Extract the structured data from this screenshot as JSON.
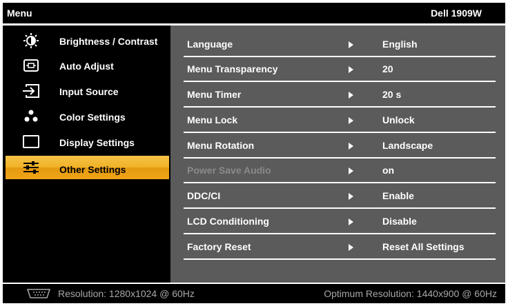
{
  "header": {
    "title": "Menu",
    "model": "Dell 1909W"
  },
  "sidebar": {
    "items": [
      {
        "label": "Brightness / Contrast",
        "icon": "brightness-icon"
      },
      {
        "label": "Auto Adjust",
        "icon": "auto-adjust-icon"
      },
      {
        "label": "Input Source",
        "icon": "input-source-icon"
      },
      {
        "label": "Color Settings",
        "icon": "color-settings-icon"
      },
      {
        "label": "Display Settings",
        "icon": "display-settings-icon"
      },
      {
        "label": "Other Settings",
        "icon": "other-settings-icon",
        "selected": true
      }
    ]
  },
  "settings": {
    "rows": [
      {
        "name": "Language",
        "value": "English"
      },
      {
        "name": "Menu Transparency",
        "value": "20"
      },
      {
        "name": "Menu Timer",
        "value": "20 s"
      },
      {
        "name": "Menu Lock",
        "value": "Unlock"
      },
      {
        "name": "Menu Rotation",
        "value": "Landscape"
      },
      {
        "name": "Power Save Audio",
        "value": "on",
        "disabled": true
      },
      {
        "name": "DDC/CI",
        "value": "Enable"
      },
      {
        "name": "LCD Conditioning",
        "value": "Disable"
      },
      {
        "name": "Factory Reset",
        "value": "Reset All Settings"
      }
    ]
  },
  "footer": {
    "input_icon": "vga-icon",
    "resolution": "Resolution: 1280x1024 @ 60Hz",
    "optimum": "Optimum Resolution: 1440x900 @ 60Hz"
  },
  "colors": {
    "background": "#000000",
    "panel": "#5b5b5b",
    "highlight": "#f1b225",
    "text": "#ffffff",
    "disabled_text": "#8a8a8a",
    "footer_text": "#a8a8a8"
  }
}
